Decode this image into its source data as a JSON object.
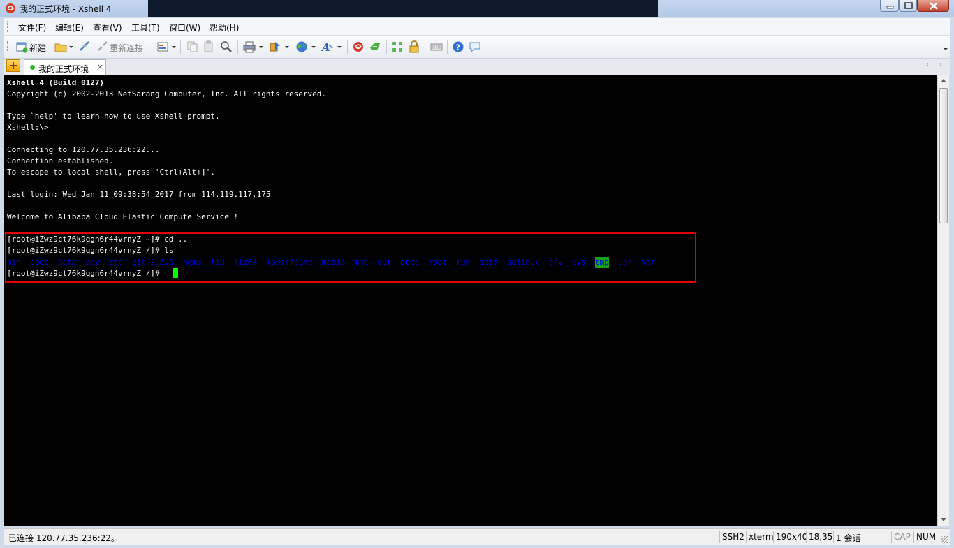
{
  "window": {
    "title": "我的正式环境 - Xshell 4",
    "app_icon": "xshell-red-spiral-icon"
  },
  "menu": [
    "文件(F)",
    "编辑(E)",
    "查看(V)",
    "工具(T)",
    "窗口(W)",
    "帮助(H)"
  ],
  "toolbar": {
    "new_label": "新建",
    "reconnect_label": "重新连接"
  },
  "tabs": [
    {
      "label": "我的正式环境",
      "close": "×"
    }
  ],
  "tab_nav": {
    "prev": "‹",
    "next": "›"
  },
  "terminal": {
    "lines": [
      "Xshell 4 (Build 0127)",
      "Copyright (c) 2002-2013 NetSarang Computer, Inc. All rights reserved.",
      "",
      "Type `help' to learn how to use Xshell prompt.",
      "Xshell:\\>",
      "",
      "Connecting to 120.77.35.236:22...",
      "Connection established.",
      "To escape to local shell, press 'Ctrl+Alt+]'.",
      "",
      "Last login: Wed Jan 11 09:38:54 2017 from 114.119.117.175",
      "",
      "Welcome to Alibaba Cloud Elastic Compute Service !",
      "",
      "[root@iZwz9ct76k9qgn6r44vrnyZ ~]# cd ..",
      "[root@iZwz9ct76k9qgn6r44vrnyZ /]# ls"
    ],
    "ls_output": [
      "bin",
      "boot",
      "data",
      "dev",
      "etc",
      "git-2.3.0",
      "home",
      "lib",
      "lib64",
      "lost+found",
      "media",
      "mnt",
      "opt",
      "proc",
      "root",
      "run",
      "sbin",
      "selinux",
      "srv",
      "sys",
      "tmp",
      "usr",
      "var"
    ],
    "ls_highlighted": "tmp",
    "prompt": "[root@iZwz9ct76k9qgn6r44vrnyZ /]#",
    "colors": {
      "bg": "#000000",
      "fg": "#ffffff",
      "dir": "#0000ff",
      "highlight_bg": "#17a317",
      "cursor": "#00ff00",
      "annotation": "#e00000"
    }
  },
  "status": {
    "connection": "已连接 120.77.35.236:22。",
    "protocol": "SSH2",
    "term": "xterm",
    "size": "190x40",
    "position": "18,35",
    "sessions": "1 会话",
    "cap": "CAP",
    "num": "NUM"
  }
}
